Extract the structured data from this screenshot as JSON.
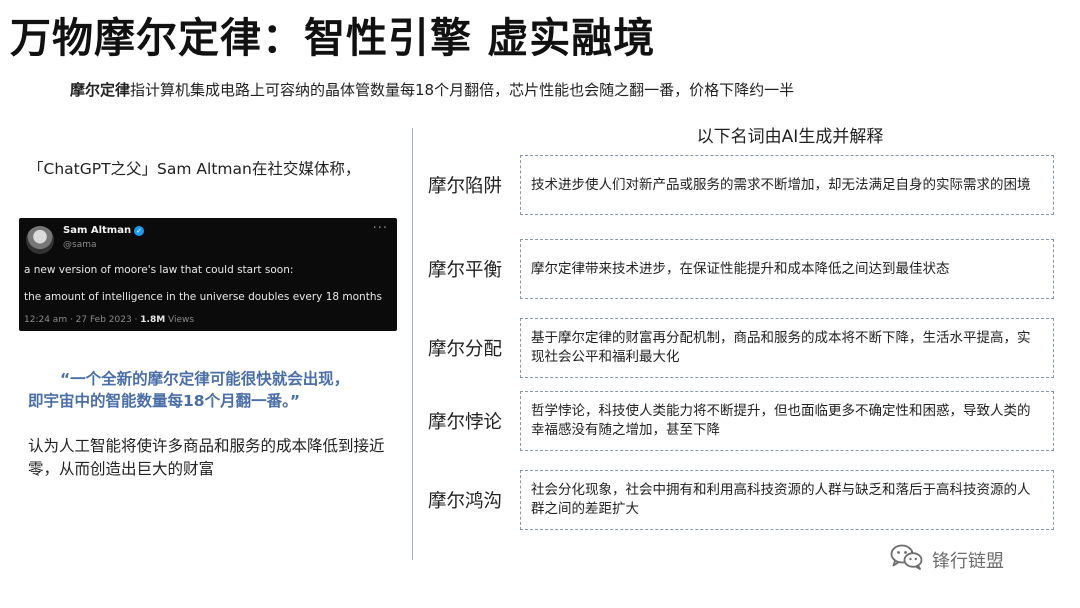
{
  "title": "万物摩尔定律：智性引擎  虚实融境",
  "definition": {
    "term": "摩尔定律",
    "text": "指计算机集成电路上可容纳的晶体管数量每18个月翻倍，芯片性能也会随之翻一番，价格下降约一半"
  },
  "left": {
    "intro": "「ChatGPT之父」Sam Altman在社交媒体称，",
    "tweet": {
      "name": "Sam Altman",
      "handle": "@sama",
      "more": "···",
      "line1": "a new version of moore's law that could start soon:",
      "line2": "the amount of intelligence in the universe doubles every 18 months",
      "time": "12:24 am · 27 Feb 2023 · ",
      "views_count": "1.8M",
      "views_label": " Views"
    },
    "quote_line1": "“一个全新的摩尔定律可能很快就会出现，",
    "quote_line2": "即宇宙中的智能数量每18个月翻一番。”",
    "conclusion": "认为人工智能将使许多商品和服务的成本降低到接近零，从而创造出巨大的财富"
  },
  "right": {
    "header": "以下名词由AI生成并解释",
    "terms": [
      {
        "name": "摩尔陷阱",
        "desc": "技术进步使人们对新产品或服务的需求不断增加，却无法满足自身的实际需求的困境"
      },
      {
        "name": "摩尔平衡",
        "desc": "摩尔定律带来技术进步，在保证性能提升和成本降低之间达到最佳状态"
      },
      {
        "name": "摩尔分配",
        "desc": "基于摩尔定律的财富再分配机制，商品和服务的成本将不断下降，生活水平提高，实现社会公平和福利最大化"
      },
      {
        "name": "摩尔悖论",
        "desc": "哲学悖论，科技使人类能力将不断提升，但也面临更多不确定性和困惑，导致人类的幸福感没有随之增加，甚至下降"
      },
      {
        "name": "摩尔鸿沟",
        "desc": "社会分化现象，社会中拥有和利用高科技资源的人群与缺乏和落后于高科技资源的人群之间的差距扩大"
      }
    ]
  },
  "watermark": {
    "text": "锋行链盟",
    "icon": "wechat-icon"
  },
  "colors": {
    "quote": "#4a6fa8",
    "tweet_bg": "#0b0b0b",
    "divider": "#9bb3c9",
    "box_border": "#8a98a8"
  }
}
